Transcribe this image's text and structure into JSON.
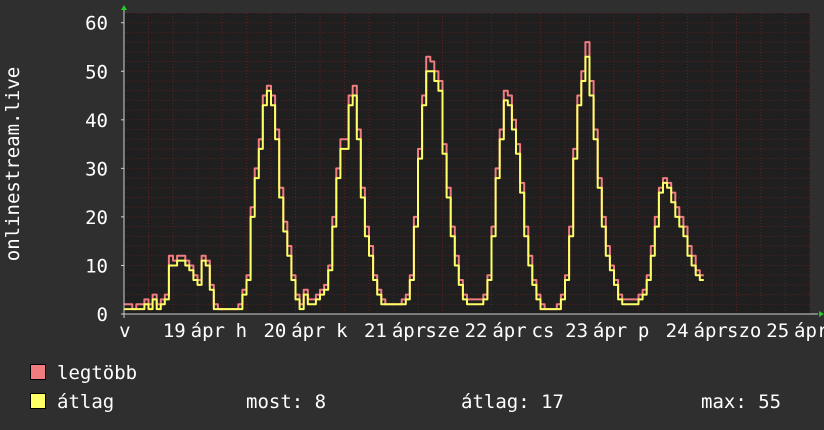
{
  "chart_data": {
    "type": "line",
    "ylabel": "onlinestream.live",
    "ylim": [
      0,
      62
    ],
    "y_ticks": [
      0,
      10,
      20,
      30,
      40,
      50,
      60
    ],
    "grid": true,
    "x_tick_labels": [
      "v",
      "19",
      "ápr",
      "h",
      "20",
      "ápr",
      "k",
      "21",
      "ápr",
      "sze",
      "22",
      "ápr",
      "cs",
      "23",
      "ápr",
      "p",
      "24",
      "ápr",
      "szo",
      "25",
      "ápr"
    ],
    "x_range_hours": [
      0,
      168
    ],
    "sample_step_hours": 1,
    "series": [
      {
        "name": "legtöbb",
        "values": [
          2,
          2,
          1,
          2,
          2,
          3,
          2,
          4,
          2,
          3,
          4,
          12,
          11,
          12,
          12,
          11,
          10,
          8,
          7,
          12,
          11,
          6,
          2,
          1,
          1,
          1,
          1,
          1,
          2,
          5,
          8,
          22,
          30,
          36,
          45,
          47,
          45,
          38,
          26,
          19,
          14,
          8,
          4,
          2,
          5,
          3,
          3,
          4,
          5,
          6,
          10,
          20,
          30,
          36,
          36,
          45,
          47,
          38,
          26,
          18,
          14,
          8,
          5,
          3,
          2,
          2,
          2,
          2,
          3,
          4,
          8,
          20,
          34,
          45,
          53,
          52,
          50,
          48,
          35,
          26,
          18,
          12,
          7,
          4,
          3,
          3,
          3,
          3,
          4,
          8,
          18,
          30,
          38,
          46,
          45,
          40,
          35,
          27,
          18,
          12,
          7,
          4,
          2,
          1,
          1,
          1,
          2,
          4,
          8,
          18,
          34,
          45,
          50,
          56,
          48,
          38,
          28,
          20,
          14,
          10,
          7,
          4,
          3,
          3,
          3,
          3,
          4,
          5,
          8,
          14,
          20,
          26,
          28,
          27,
          25,
          22,
          20,
          18,
          14,
          12,
          9,
          8
        ]
      },
      {
        "name": "átlag",
        "values": [
          1,
          1,
          1,
          1,
          1,
          2,
          1,
          3,
          1,
          2,
          3,
          10,
          10,
          11,
          11,
          10,
          9,
          7,
          6,
          11,
          10,
          5,
          1,
          1,
          1,
          1,
          1,
          1,
          1,
          4,
          7,
          20,
          28,
          34,
          43,
          46,
          43,
          36,
          24,
          17,
          12,
          7,
          3,
          1,
          4,
          2,
          2,
          3,
          4,
          5,
          9,
          18,
          28,
          34,
          34,
          43,
          45,
          36,
          24,
          16,
          12,
          7,
          4,
          2,
          2,
          2,
          2,
          2,
          2,
          3,
          7,
          18,
          32,
          43,
          50,
          50,
          48,
          46,
          33,
          24,
          16,
          10,
          6,
          3,
          2,
          2,
          2,
          2,
          3,
          7,
          16,
          28,
          36,
          44,
          43,
          38,
          33,
          25,
          16,
          10,
          6,
          3,
          1,
          1,
          1,
          1,
          1,
          3,
          7,
          16,
          32,
          43,
          48,
          53,
          45,
          36,
          26,
          18,
          12,
          9,
          6,
          3,
          2,
          2,
          2,
          2,
          3,
          4,
          7,
          12,
          18,
          25,
          27,
          26,
          23,
          20,
          18,
          16,
          12,
          10,
          8,
          7
        ]
      }
    ]
  },
  "legend": {
    "max_label": "legtöbb",
    "avg_label": "átlag",
    "max_color": "#f07c80",
    "avg_color": "#ffff66"
  },
  "stats": {
    "current": "most: 8",
    "average": "átlag: 17",
    "maximum": "max: 55"
  },
  "colors": {
    "background": "#2f2f2f",
    "plot_background": "#1f1f1f",
    "grid": "#6a2020",
    "axis": "#d0d0d0",
    "arrow": "#22cc22"
  }
}
